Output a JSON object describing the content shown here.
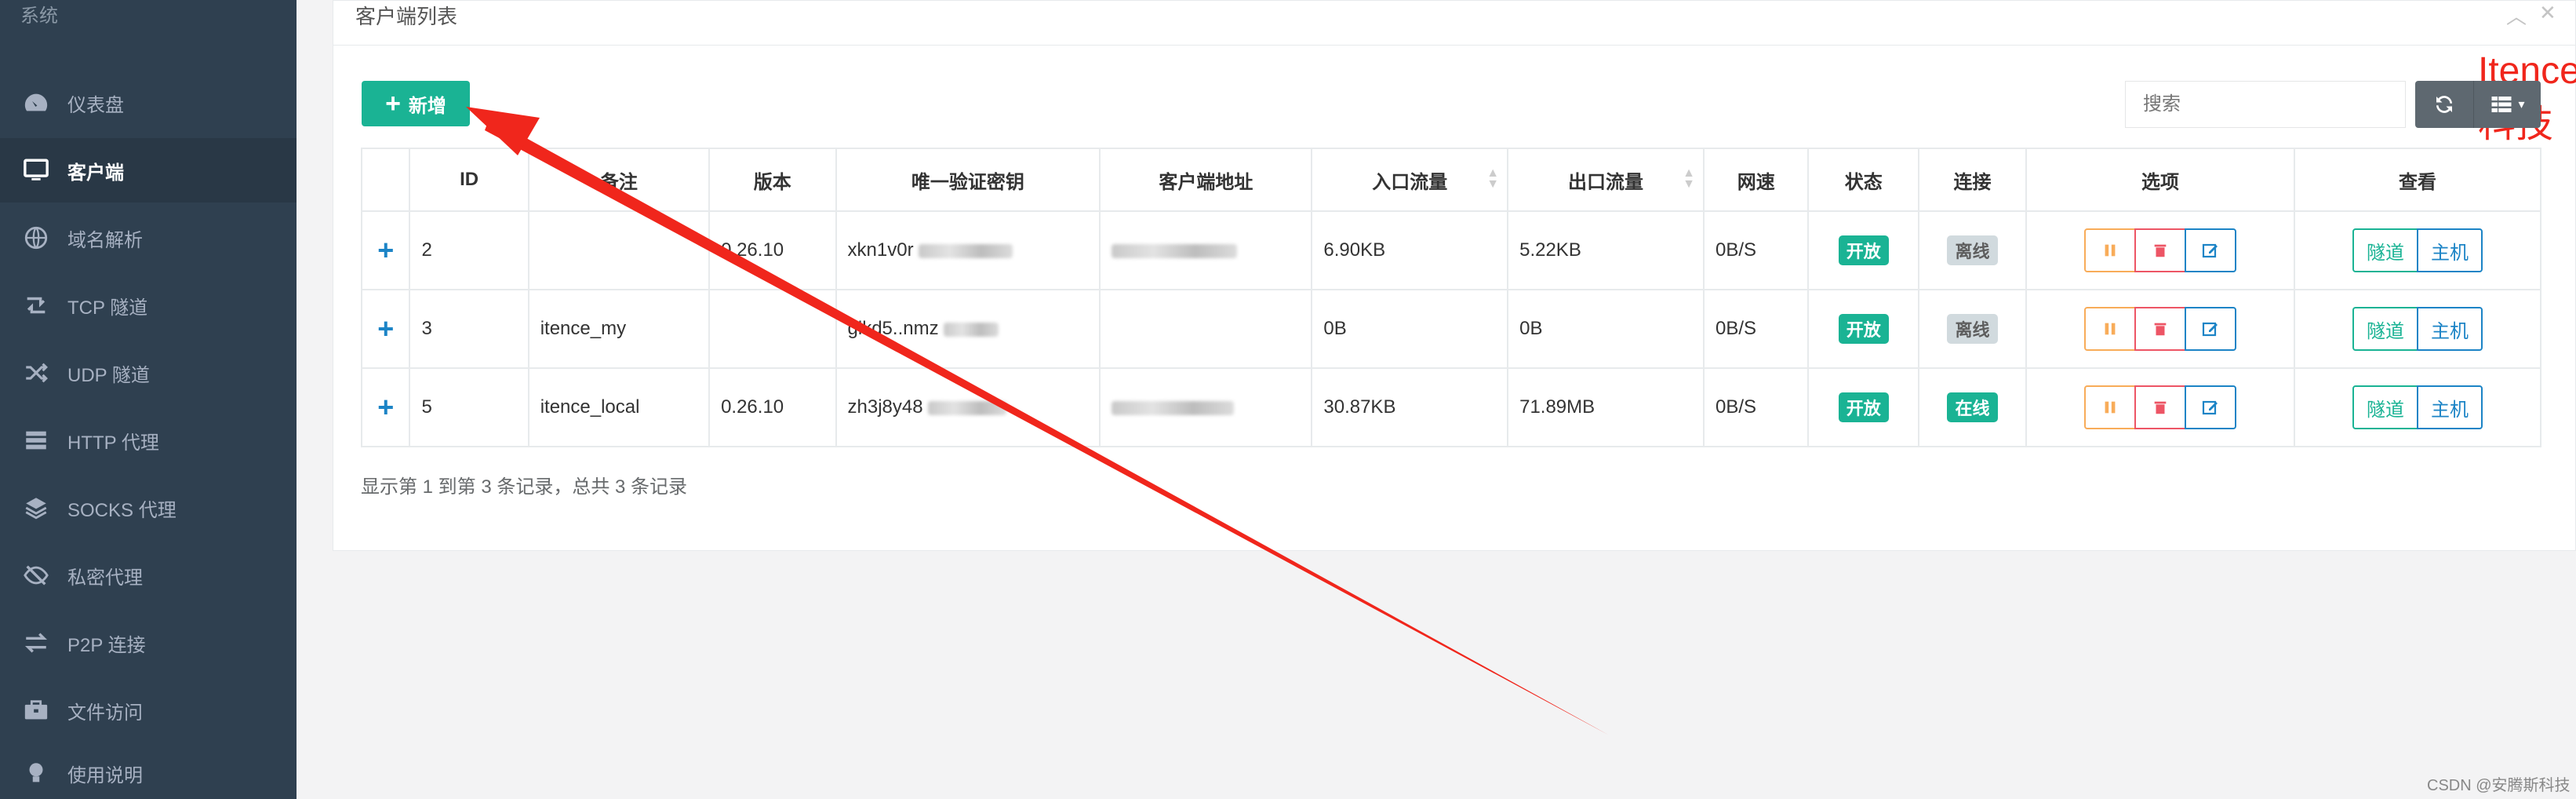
{
  "sidebar": {
    "section": "系统",
    "items": [
      {
        "label": "仪表盘",
        "icon": "dashboard-icon",
        "active": false
      },
      {
        "label": "客户端",
        "icon": "monitor-icon",
        "active": true
      },
      {
        "label": "域名解析",
        "icon": "globe-icon",
        "active": false
      },
      {
        "label": "TCP 隧道",
        "icon": "retweet-icon",
        "active": false
      },
      {
        "label": "UDP 隧道",
        "icon": "shuffle-icon",
        "active": false
      },
      {
        "label": "HTTP 代理",
        "icon": "server-icon",
        "active": false
      },
      {
        "label": "SOCKS 代理",
        "icon": "layers-icon",
        "active": false
      },
      {
        "label": "私密代理",
        "icon": "eye-slash-icon",
        "active": false
      },
      {
        "label": "P2P 连接",
        "icon": "exchange-icon",
        "active": false
      },
      {
        "label": "文件访问",
        "icon": "briefcase-icon",
        "active": false
      },
      {
        "label": "使用说明",
        "icon": "lightbulb-icon",
        "active": false
      }
    ]
  },
  "panel": {
    "title": "客户端列表",
    "add_label": "新增",
    "search_placeholder": "搜索",
    "brand_overlay": "Itence科技"
  },
  "table": {
    "headers": {
      "id": "ID",
      "remark": "备注",
      "version": "版本",
      "vkey": "唯一验证密钥",
      "addr": "客户端地址",
      "in_flow": "入口流量",
      "out_flow": "出口流量",
      "speed": "网速",
      "status": "状态",
      "conn": "连接",
      "ops": "选项",
      "view": "查看"
    },
    "rows": [
      {
        "id": "2",
        "remark": "",
        "version": "0.26.10",
        "vkey": "xkn1v0r",
        "addr_hidden": true,
        "in_flow": "6.90KB",
        "out_flow": "5.22KB",
        "speed": "0B/S",
        "status": "开放",
        "conn": "离线"
      },
      {
        "id": "3",
        "remark": "itence_my",
        "version": "",
        "vkey": "glkd5..nmz",
        "addr_hidden": false,
        "in_flow": "0B",
        "out_flow": "0B",
        "speed": "0B/S",
        "status": "开放",
        "conn": "离线"
      },
      {
        "id": "5",
        "remark": "itence_local",
        "version": "0.26.10",
        "vkey": "zh3j8y48",
        "addr_hidden": true,
        "in_flow": "30.87KB",
        "out_flow": "71.89MB",
        "speed": "0B/S",
        "status": "开放",
        "conn": "在线"
      }
    ],
    "tunnel_label": "隧道",
    "host_label": "主机",
    "summary": "显示第 1 到第 3 条记录，总共 3 条记录"
  },
  "colors": {
    "sidebar_bg": "#2f4050",
    "accent": "#1ab394",
    "danger": "#ed5565",
    "warning": "#f8ac59",
    "primary": "#1c84c6",
    "annotation_arrow": "#f0261c"
  },
  "csdn_watermark": "CSDN @安腾斯科技"
}
